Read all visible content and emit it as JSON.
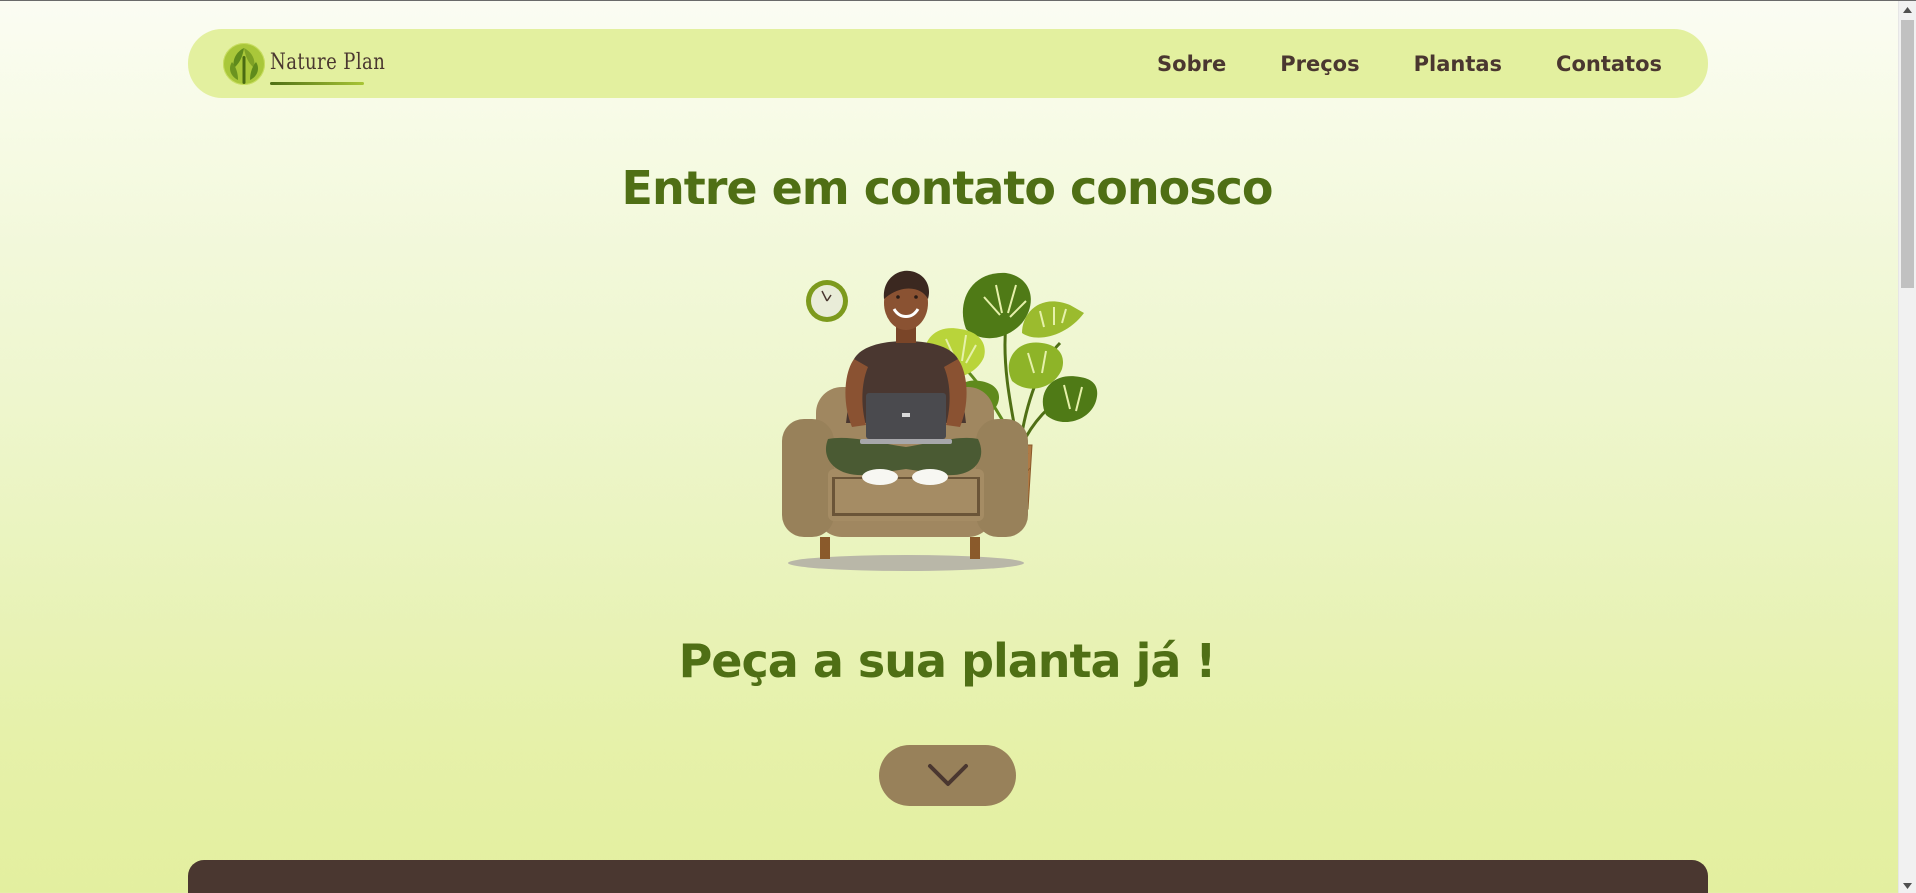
{
  "brand": {
    "name": "Nature Plan",
    "colors": {
      "nav_bg": "#e3f09f",
      "text_dark": "#4a3730",
      "heading_green": "#4f6f15",
      "button_brown": "#98815a"
    }
  },
  "nav": {
    "links": [
      {
        "label": "Sobre"
      },
      {
        "label": "Preços"
      },
      {
        "label": "Plantas"
      },
      {
        "label": "Contatos"
      }
    ]
  },
  "hero": {
    "title": "Entre em contato conosco",
    "subtitle": "Peça a sua planta já !",
    "scroll_icon": "chevron-down-icon"
  },
  "illustration": {
    "icon": "man-with-laptop-on-armchair-illustration"
  }
}
